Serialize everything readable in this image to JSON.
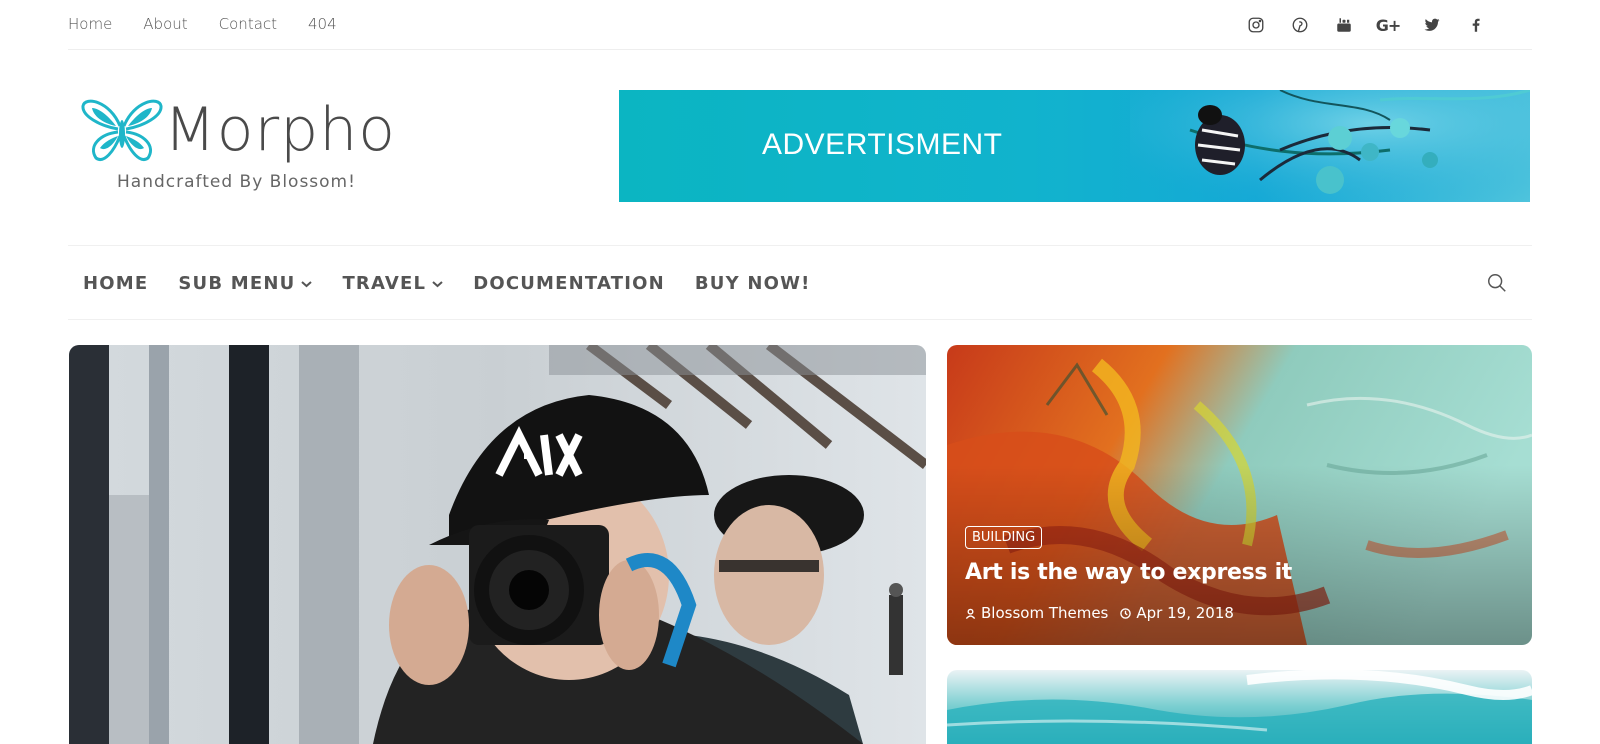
{
  "top_nav": {
    "items": [
      "Home",
      "About",
      "Contact",
      "404"
    ]
  },
  "social": {
    "icons": [
      "instagram-icon",
      "pinterest-icon",
      "youtube-icon",
      "google-plus-icon",
      "twitter-icon",
      "facebook-icon"
    ],
    "google_plus_glyph": "G+"
  },
  "header": {
    "site_title": "Morpho",
    "tagline": "Handcrafted By Blossom!",
    "logo_color": "#1fb6c9",
    "ad_text": "ADVERTISMENT"
  },
  "main_nav": {
    "items": [
      {
        "label": "HOME"
      },
      {
        "label": "SUB MENU"
      },
      {
        "label": "TRAVEL"
      },
      {
        "label": "DOCUMENTATION"
      },
      {
        "label": "BUY NOW!"
      }
    ]
  },
  "featured": {
    "card": {
      "category": "BUILDING",
      "title": "Art is the way to express it",
      "author": "Blossom Themes",
      "date": "Apr 19, 2018"
    }
  },
  "colors": {
    "accent": "#1fb6c9",
    "text": "#555555"
  }
}
